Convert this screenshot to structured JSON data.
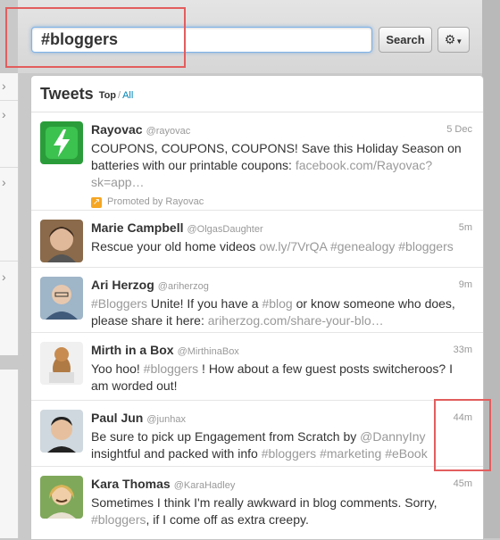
{
  "search": {
    "value": "#bloggers",
    "button_label": "Search",
    "gear_icon": "gear-icon"
  },
  "panel": {
    "title": "Tweets",
    "filter_top": "Top",
    "filter_sep": "/",
    "filter_all": "All"
  },
  "colors": {
    "link": "#0084b4",
    "muted": "#999999",
    "highlight": "#e25d5d",
    "promo": "#f5a623"
  },
  "tweets": [
    {
      "name": "Rayovac",
      "handle": "@rayovac",
      "time": "5 Dec",
      "parts": [
        {
          "t": "COUPONS, COUPONS, COUPONS! Save this Holiday Season on batteries with our printable coupons: ",
          "muted": false
        },
        {
          "t": "facebook.com/Rayovac?sk=app…",
          "muted": true
        }
      ],
      "promoted": "Promoted by Rayovac"
    },
    {
      "name": "Marie Campbell",
      "handle": "@OlgasDaughter",
      "time": "5m",
      "parts": [
        {
          "t": "Rescue your old home videos ",
          "muted": false
        },
        {
          "t": "ow.ly/7VrQA",
          "muted": true
        },
        {
          "t": " ",
          "muted": false
        },
        {
          "t": "#genealogy",
          "muted": true
        },
        {
          "t": " ",
          "muted": false
        },
        {
          "t": "#bloggers",
          "muted": true
        }
      ]
    },
    {
      "name": "Ari Herzog",
      "handle": "@ariherzog",
      "time": "9m",
      "parts": [
        {
          "t": "#Bloggers",
          "muted": true
        },
        {
          "t": " Unite! If you have a ",
          "muted": false
        },
        {
          "t": "#blog",
          "muted": true
        },
        {
          "t": " or know someone who does, please share it here: ",
          "muted": false
        },
        {
          "t": "ariherzog.com/share-your-blo…",
          "muted": true
        }
      ]
    },
    {
      "name": "Mirth in a Box",
      "handle": "@MirthinaBox",
      "time": "33m",
      "parts": [
        {
          "t": "Yoo hoo! ",
          "muted": false
        },
        {
          "t": "#bloggers",
          "muted": true
        },
        {
          "t": " ! How about a few guest posts switcheroos? I am worded out!",
          "muted": false
        }
      ]
    },
    {
      "name": "Paul Jun",
      "handle": "@junhax",
      "time": "44m",
      "parts": [
        {
          "t": "Be sure to pick up Engagement from Scratch by ",
          "muted": false
        },
        {
          "t": "@DannyIny",
          "muted": true
        },
        {
          "t": " insightful and packed with info ",
          "muted": false
        },
        {
          "t": "#bloggers",
          "muted": true
        },
        {
          "t": " ",
          "muted": false
        },
        {
          "t": "#marketing",
          "muted": true
        },
        {
          "t": " ",
          "muted": false
        },
        {
          "t": "#eBook",
          "muted": true
        }
      ]
    },
    {
      "name": "Kara Thomas",
      "handle": "@KaraHadley",
      "time": "45m",
      "parts": [
        {
          "t": "Sometimes I think I'm really awkward in blog comments. Sorry, ",
          "muted": false
        },
        {
          "t": "#bloggers",
          "muted": true
        },
        {
          "t": ", if I come off as extra creepy.",
          "muted": false
        }
      ]
    }
  ]
}
